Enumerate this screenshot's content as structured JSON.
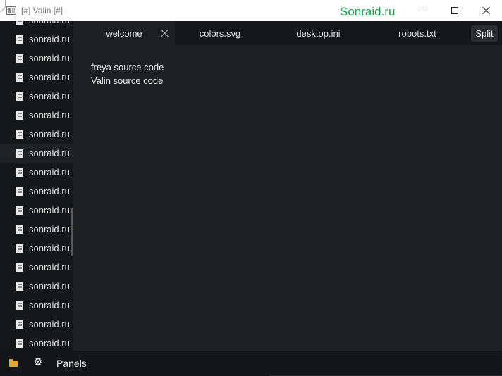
{
  "window": {
    "title": "[#] Valin [#]",
    "watermark": "Sonraid.ru",
    "controls": [
      "minimize",
      "maximize",
      "close"
    ]
  },
  "sidebar": {
    "files": [
      {
        "label": "sonraid.ru."
      },
      {
        "label": "sonraid.ru."
      },
      {
        "label": "sonraid.ru."
      },
      {
        "label": "sonraid.ru."
      },
      {
        "label": "sonraid.ru."
      },
      {
        "label": "sonraid.ru."
      },
      {
        "label": "sonraid.ru."
      },
      {
        "label": "sonraid.ru.",
        "active": true
      },
      {
        "label": "sonraid.ru."
      },
      {
        "label": "sonraid.ru."
      },
      {
        "label": "sonraid.ru."
      },
      {
        "label": "sonraid.ru."
      },
      {
        "label": "sonraid.ru."
      },
      {
        "label": "sonraid.ru."
      },
      {
        "label": "sonraid.ru."
      },
      {
        "label": "sonraid.ru."
      },
      {
        "label": "sonraid.ru."
      },
      {
        "label": "sonraid.ru."
      }
    ]
  },
  "tabs": [
    {
      "label": "welcome",
      "active": true
    },
    {
      "label": "colors.svg"
    },
    {
      "label": "desktop.ini"
    },
    {
      "label": "robots.txt"
    }
  ],
  "split_label": "Split",
  "editor": {
    "lines": [
      "freya source code",
      "Valin source code"
    ]
  },
  "bottom": {
    "panels_label": "Panels",
    "icons": [
      "folder-icon",
      "gear-icon"
    ]
  },
  "colors": {
    "watermark": "#1ca34a",
    "background": "#1f2021",
    "sidebar": "#161718",
    "folder": "#e2a52f"
  }
}
